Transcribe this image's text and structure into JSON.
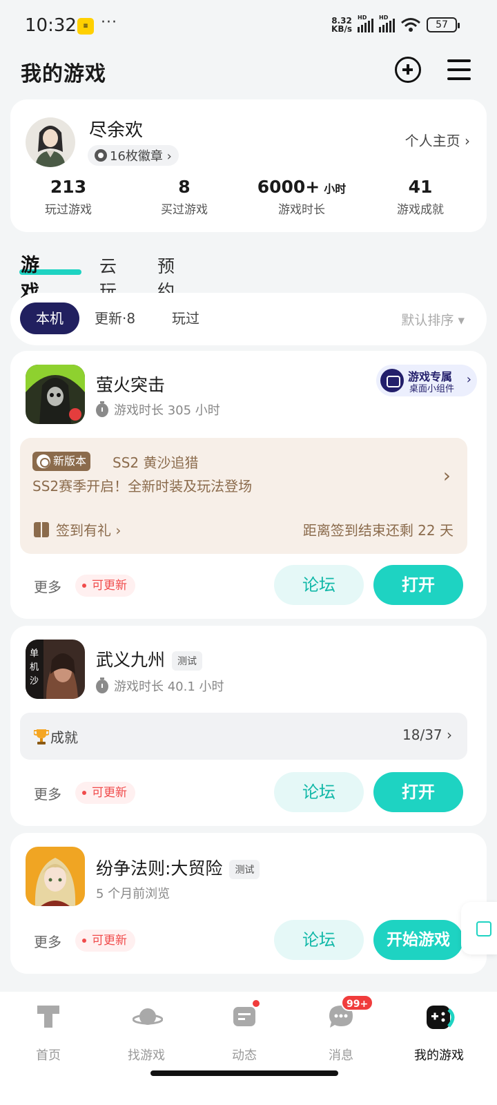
{
  "status_bar": {
    "time": "10:32",
    "app_badge": "",
    "dots": "···",
    "net_speed_top": "8.32",
    "net_speed_bottom": "KB/s",
    "hd1": "HD",
    "hd2": "HD",
    "battery": "57"
  },
  "header": {
    "title": "我的游戏"
  },
  "profile": {
    "name": "尽余欢",
    "badges": "16枚徽章 ›",
    "home_link": "个人主页 ›",
    "stats": [
      {
        "value": "213",
        "unit": "",
        "label": "玩过游戏"
      },
      {
        "value": "8",
        "unit": "",
        "label": "买过游戏"
      },
      {
        "value": "6000+",
        "unit": "小时",
        "label": "游戏时长"
      },
      {
        "value": "41",
        "unit": "",
        "label": "游戏成就"
      }
    ]
  },
  "tabs": [
    "游戏库",
    "云玩",
    "预约"
  ],
  "filter": {
    "chips": [
      "本机",
      "更新·8",
      "玩过"
    ],
    "sort": "默认排序 ▾"
  },
  "games": [
    {
      "title": "萤火突击",
      "tag": "",
      "subtitle": "游戏时长 305 小时",
      "widget": {
        "line1": "游戏专属",
        "line2": "桌面小组件",
        "chevron": "›"
      },
      "promo": {
        "badge": "新版本",
        "title": "SS2 黄沙追猎",
        "desc": "SS2赛季开启！全新时装及玩法登场",
        "checkin": "签到有礼 ›",
        "remaining": "距离签到结束还剩 22 天",
        "chevron": "›"
      },
      "more": "更多",
      "update": "可更新",
      "forum": "论坛",
      "action": "打开"
    },
    {
      "title": "武义九州",
      "tag": "测试",
      "subtitle": "游戏时长 40.1 小时",
      "achievement": {
        "label": "成就",
        "count": "18/37 ›"
      },
      "more": "更多",
      "update": "可更新",
      "forum": "论坛",
      "action": "打开"
    },
    {
      "title": "纷争法则:大贸险",
      "tag": "测试",
      "subtitle": "5 个月前浏览",
      "more": "更多",
      "update": "可更新",
      "forum": "论坛",
      "action": "开始游戏"
    }
  ],
  "bottom_nav": [
    {
      "label": "首页",
      "icon": "home-icon"
    },
    {
      "label": "找游戏",
      "icon": "planet-icon"
    },
    {
      "label": "动态",
      "icon": "feed-icon"
    },
    {
      "label": "消息",
      "icon": "message-icon",
      "badge": "99+"
    },
    {
      "label": "我的游戏",
      "icon": "gamepad-icon"
    }
  ],
  "colors": {
    "accent": "#1ed3c2",
    "navy": "#21205f",
    "promo_text": "#8b6b4c",
    "update_red": "#f04b4b"
  }
}
